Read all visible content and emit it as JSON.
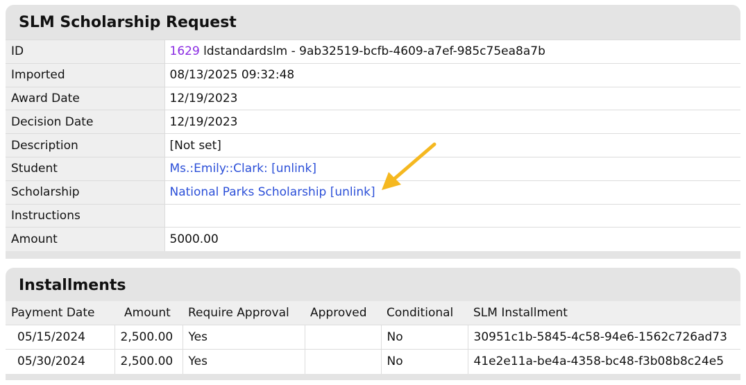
{
  "request": {
    "title": "SLM Scholarship Request",
    "rows": [
      {
        "label": "ID",
        "id_number": "1629",
        "value": " ldstandardslm - 9ab32519-bcfb-4609-a7ef-985c75ea8a7b"
      },
      {
        "label": "Imported",
        "value": "08/13/2025 09:32:48"
      },
      {
        "label": "Award Date",
        "value": "12/19/2023"
      },
      {
        "label": "Decision Date",
        "value": "12/19/2023"
      },
      {
        "label": "Description",
        "value": "[Not set]"
      },
      {
        "label": "Student",
        "value": "Ms.:Emily::Clark: [unlink]"
      },
      {
        "label": "Scholarship",
        "value": "National Parks Scholarship [unlink]"
      },
      {
        "label": "Instructions",
        "value": ""
      },
      {
        "label": "Amount",
        "value": "5000.00"
      }
    ]
  },
  "installments": {
    "title": "Installments",
    "headers": [
      "Payment Date",
      "Amount",
      "Require Approval",
      "Approved",
      "Conditional",
      "SLM Installment"
    ],
    "rows": [
      {
        "payment_date": "05/15/2024",
        "amount": "2,500.00",
        "require_approval": "Yes",
        "approved": "",
        "conditional": "No",
        "slm_installment": "30951c1b-5845-4c58-94e6-1562c726ad73"
      },
      {
        "payment_date": "05/30/2024",
        "amount": "2,500.00",
        "require_approval": "Yes",
        "approved": "",
        "conditional": "No",
        "slm_installment": "41e2e11a-be4a-4358-bc48-f3b08b8c24e5"
      }
    ]
  },
  "colors": {
    "accent_purple": "#8a2be2",
    "link_blue": "#2b4fd8",
    "annotation_arrow": "#f5b820",
    "panel_header": "#e4e4e4"
  },
  "icons": {
    "annotation": "arrow-pointer-icon"
  }
}
